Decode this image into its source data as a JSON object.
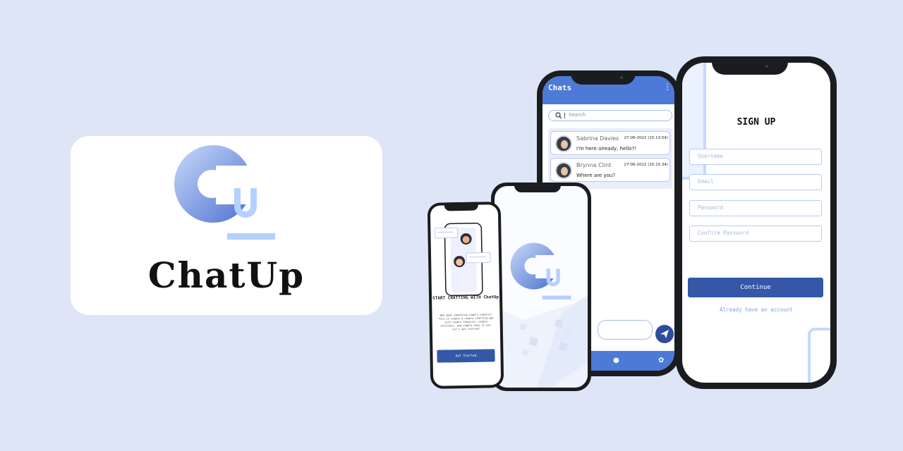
{
  "brand": {
    "name": "ChatUp"
  },
  "onboarding": {
    "title": "START CHATTING WITH ChatUp",
    "description": "Who make something simple complex? This is simply a simple chatting app with simple features, simple interface, and simply easy to use. Let's get started!",
    "get_started": "Get Started"
  },
  "chats": {
    "title": "Chats",
    "search_placeholder": "Search",
    "items": [
      {
        "name": "Sabrina Davies",
        "time": "27-06-2022 (15.13.54)",
        "message": "I'm here already, hello?!"
      },
      {
        "name": "Brynna Clint",
        "time": "27-06-2022 (15.15.34)",
        "message": "Where are you?"
      }
    ]
  },
  "signup": {
    "title": "SIGN UP",
    "username_placeholder": "Username",
    "email_placeholder": "Email",
    "password_placeholder": "Password",
    "confirm_password_placeholder": "Confirm Password",
    "continue": "Continue",
    "signin_link": "Already have an account"
  },
  "colors": {
    "background": "#dde5f7",
    "primary": "#3457a7",
    "accent": "#4d7ad7",
    "light": "#c5d9ff"
  },
  "icons": [
    "chatup-logo",
    "search-icon",
    "send-icon",
    "user-icon",
    "flower-icon",
    "more-vert-icon"
  ]
}
